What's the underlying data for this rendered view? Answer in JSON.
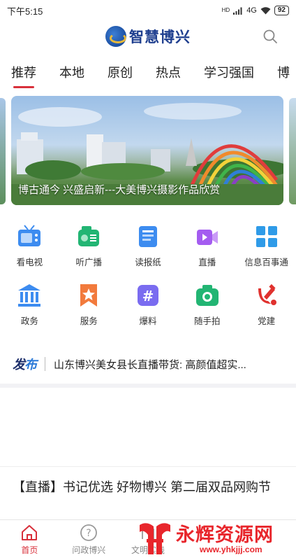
{
  "status_bar": {
    "time": "下午5:15",
    "network": "4G",
    "hd": "HD",
    "battery": "92"
  },
  "header": {
    "app_name": "智慧博兴",
    "search_icon": "search-icon"
  },
  "tabs": [
    {
      "label": "推荐",
      "active": true
    },
    {
      "label": "本地"
    },
    {
      "label": "原创"
    },
    {
      "label": "热点"
    },
    {
      "label": "学习强国"
    },
    {
      "label": "博"
    }
  ],
  "banner": {
    "caption": "博古通今  兴盛启新---大美博兴摄影作品欣赏"
  },
  "services": [
    {
      "label": "看电视",
      "icon": "tv-icon",
      "color": "#3d8cf0"
    },
    {
      "label": "听广播",
      "icon": "radio-icon",
      "color": "#22b573"
    },
    {
      "label": "读报纸",
      "icon": "newspaper-icon",
      "color": "#3d8cf0"
    },
    {
      "label": "直播",
      "icon": "live-video-icon",
      "color": "#a45cf0"
    },
    {
      "label": "信息百事通",
      "icon": "grid-icon",
      "color": "#2f9be8"
    },
    {
      "label": "政务",
      "icon": "government-icon",
      "color": "#3d8cf0"
    },
    {
      "label": "服务",
      "icon": "service-star-icon",
      "color": "#f27a3c"
    },
    {
      "label": "爆料",
      "icon": "hashtag-icon",
      "color": "#7a6cf0"
    },
    {
      "label": "随手拍",
      "icon": "camera-icon",
      "color": "#22b573"
    },
    {
      "label": "党建",
      "icon": "party-emblem-icon",
      "color": "#e0312e"
    }
  ],
  "notice": {
    "tag_a": "发",
    "tag_b": "布",
    "text": "山东博兴美女县长直播带货: 高颜值超实..."
  },
  "article": {
    "title": "【直播】书记优选 好物博兴 第二届双品网购节"
  },
  "bottom_nav": [
    {
      "label": "首页",
      "icon": "home-icon",
      "active": true
    },
    {
      "label": "问政博兴",
      "icon": "question-icon"
    },
    {
      "label": "文明实践",
      "icon": "practice-icon"
    },
    {
      "label": "",
      "icon": ""
    },
    {
      "label": "",
      "icon": ""
    }
  ],
  "watermark": {
    "text": "永辉资源网",
    "url": "www.yhkjjj.com"
  },
  "colors": {
    "accent": "#d8303b",
    "brand": "#1f3f8f"
  }
}
